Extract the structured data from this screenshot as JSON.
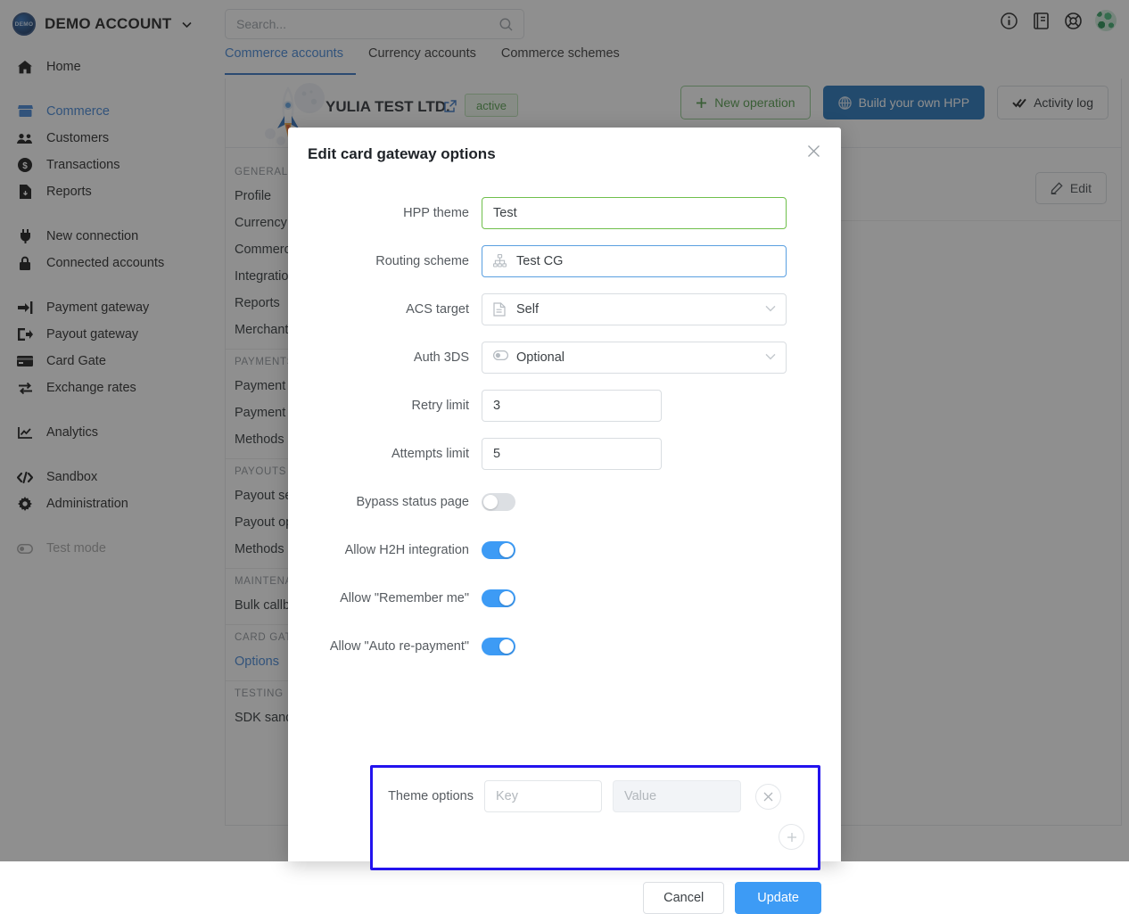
{
  "account": {
    "name": "DEMO ACCOUNT",
    "logo_text": "DEMO",
    "caret": "⌄"
  },
  "search": {
    "placeholder": "Search...",
    "icon": "search-icon"
  },
  "topbar_icons": [
    {
      "name": "info-icon"
    },
    {
      "name": "docs-icon"
    },
    {
      "name": "support-icon"
    },
    {
      "name": "avatar"
    }
  ],
  "sidebar": {
    "groups": [
      {
        "items": [
          {
            "label": "Home",
            "icon": "home-icon",
            "state": "default"
          }
        ]
      },
      {
        "items": [
          {
            "label": "Commerce",
            "icon": "store-icon",
            "state": "active"
          },
          {
            "label": "Customers",
            "icon": "users-icon",
            "state": "default"
          },
          {
            "label": "Transactions",
            "icon": "dollar-icon",
            "state": "default"
          },
          {
            "label": "Reports",
            "icon": "report-icon",
            "state": "default"
          }
        ]
      },
      {
        "items": [
          {
            "label": "New connection",
            "icon": "plug-icon",
            "state": "default"
          },
          {
            "label": "Connected accounts",
            "icon": "lock-icon",
            "state": "default"
          }
        ]
      },
      {
        "items": [
          {
            "label": "Payment gateway",
            "icon": "login-arrow-icon",
            "state": "default"
          },
          {
            "label": "Payout gateway",
            "icon": "logout-arrow-icon",
            "state": "default"
          },
          {
            "label": "Card Gate",
            "icon": "card-icon",
            "state": "default"
          },
          {
            "label": "Exchange rates",
            "icon": "exchange-icon",
            "state": "default"
          }
        ]
      },
      {
        "items": [
          {
            "label": "Analytics",
            "icon": "analytics-icon",
            "state": "default"
          }
        ]
      },
      {
        "items": [
          {
            "label": "Sandbox",
            "icon": "code-icon",
            "state": "default"
          },
          {
            "label": "Administration",
            "icon": "gear-icon",
            "state": "default"
          }
        ]
      },
      {
        "items": [
          {
            "label": "Test mode",
            "icon": "toggle-icon",
            "state": "muted"
          }
        ]
      }
    ]
  },
  "tabs": [
    {
      "label": "Commerce accounts",
      "active": true
    },
    {
      "label": "Currency accounts",
      "active": false
    },
    {
      "label": "Commerce schemes",
      "active": false
    }
  ],
  "account_header": {
    "title": "YULIA TEST LTD.",
    "external_link_icon": "external-link-icon",
    "status": "active",
    "buttons": [
      {
        "label": "New operation",
        "icon": "plus-icon",
        "style": "outline-green"
      },
      {
        "label": "Build your own HPP",
        "icon": "globe-icon",
        "style": "filled-blue"
      },
      {
        "label": "Activity log",
        "icon": "double-check-icon",
        "style": "outline-gray"
      }
    ]
  },
  "settings_nav": [
    {
      "type": "header",
      "label": "GENERAL"
    },
    {
      "type": "item",
      "label": "Profile"
    },
    {
      "type": "item",
      "label": "Currency"
    },
    {
      "type": "item",
      "label": "Commerce"
    },
    {
      "type": "item",
      "label": "Integration"
    },
    {
      "type": "item",
      "label": "Reports"
    },
    {
      "type": "item",
      "label": "Merchant"
    },
    {
      "type": "sep"
    },
    {
      "type": "header",
      "label": "PAYMENTS"
    },
    {
      "type": "item",
      "label": "Payment"
    },
    {
      "type": "item",
      "label": "Payment"
    },
    {
      "type": "item",
      "label": "Methods"
    },
    {
      "type": "sep"
    },
    {
      "type": "header",
      "label": "PAYOUTS"
    },
    {
      "type": "item",
      "label": "Payout se"
    },
    {
      "type": "item",
      "label": "Payout op"
    },
    {
      "type": "item",
      "label": "Methods"
    },
    {
      "type": "sep"
    },
    {
      "type": "header",
      "label": "MAINTENANCE"
    },
    {
      "type": "item",
      "label": "Bulk callb"
    },
    {
      "type": "sep"
    },
    {
      "type": "header",
      "label": "CARD GATE"
    },
    {
      "type": "item",
      "label": "Options",
      "selected": true
    },
    {
      "type": "sep"
    },
    {
      "type": "header",
      "label": "TESTING"
    },
    {
      "type": "item",
      "label": "SDK sandbox"
    }
  ],
  "content_actions": {
    "edit_label": "Edit",
    "edit_icon": "pencil-icon"
  },
  "modal": {
    "title": "Edit card gateway options",
    "close_icon": "close-icon",
    "fields": {
      "hpp_theme": {
        "label": "HPP theme",
        "value": "Test",
        "border": "#6fbf4b"
      },
      "routing_scheme": {
        "label": "Routing scheme",
        "value": "Test CG",
        "icon": "sitemap-icon",
        "border": "#5a9fe0"
      },
      "acs_target": {
        "label": "ACS target",
        "value": "Self",
        "icon": "document-icon",
        "caret": "chevron-down-icon"
      },
      "auth_3ds": {
        "label": "Auth 3DS",
        "value": "Optional",
        "icon": "toggle-icon",
        "caret": "chevron-down-icon"
      },
      "retry_limit": {
        "label": "Retry limit",
        "value": "3"
      },
      "attempts_limit": {
        "label": "Attempts limit",
        "value": "5"
      },
      "bypass_status_page": {
        "label": "Bypass status page",
        "on": false
      },
      "allow_h2h": {
        "label": "Allow H2H integration",
        "on": true
      },
      "allow_remember_me": {
        "label": "Allow \"Remember me\"",
        "on": true
      },
      "allow_auto_repayment": {
        "label": "Allow \"Auto re-payment\"",
        "on": true
      }
    },
    "theme_options": {
      "label": "Theme options",
      "key_placeholder": "Key",
      "value_placeholder": "Value",
      "remove_icon": "close-icon",
      "add_icon": "plus-icon",
      "highlight_color": "#2313ee"
    },
    "footer": {
      "cancel_label": "Cancel",
      "update_label": "Update",
      "update_color": "#3d9bf5"
    }
  }
}
